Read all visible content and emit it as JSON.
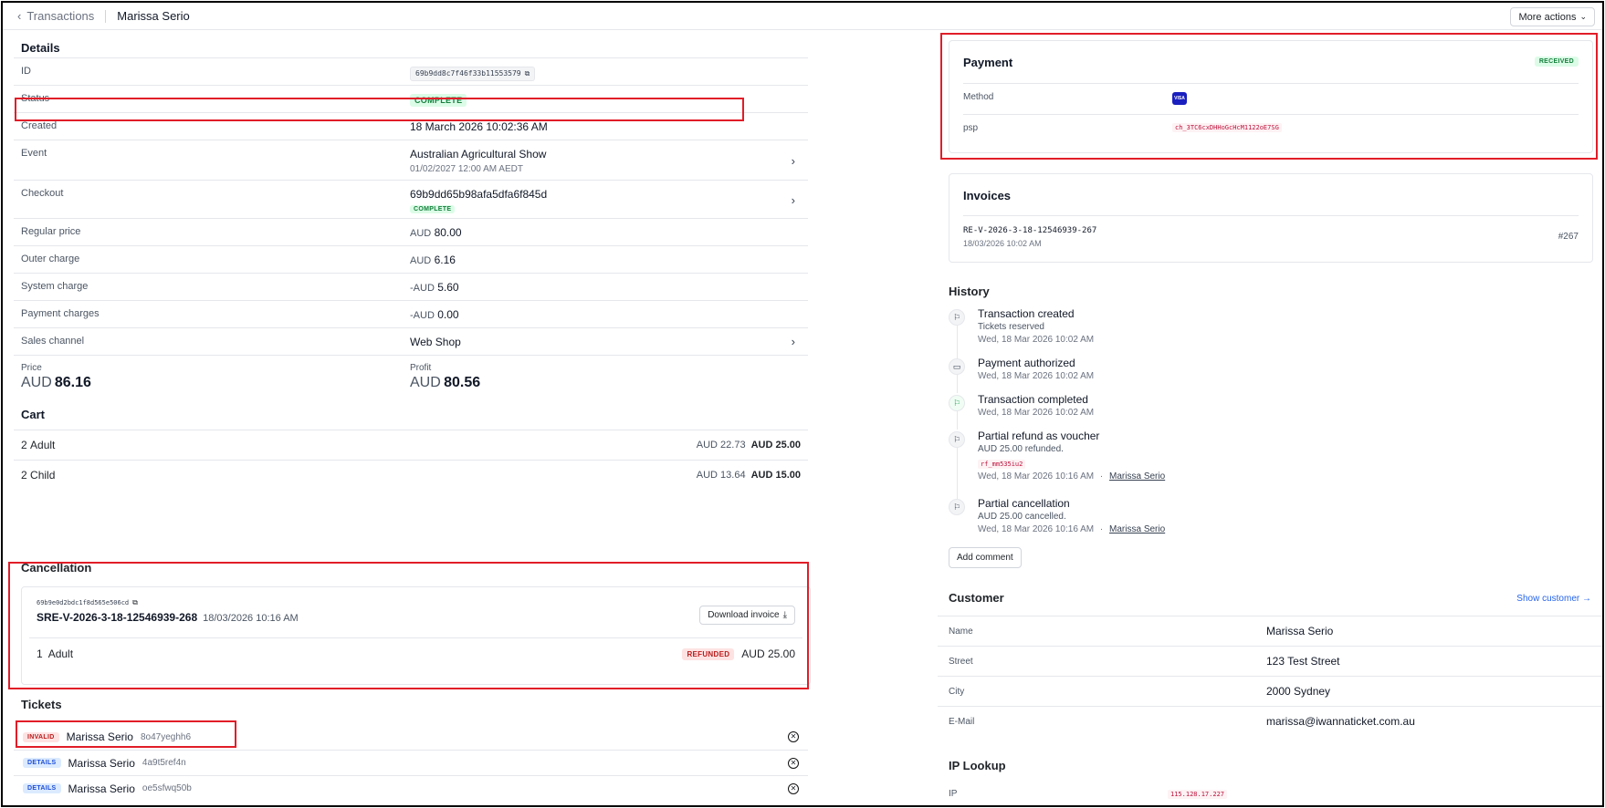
{
  "breadcrumb": {
    "back_label": "Transactions",
    "current": "Marissa Serio"
  },
  "header": {
    "more_actions": "More actions"
  },
  "details": {
    "title": "Details",
    "id_label": "ID",
    "id_value": "69b9dd8c7f46f33b11553579",
    "status_label": "Status",
    "status_value": "COMPLETE",
    "created_label": "Created",
    "created_value": "18 March 2026 10:02:36 AM",
    "event_label": "Event",
    "event_name": "Australian Agricultural Show",
    "event_date": "01/02/2027 12:00 AM AEDT",
    "checkout_label": "Checkout",
    "checkout_id": "69b9dd65b98afa5dfa6f845d",
    "checkout_status": "COMPLETE",
    "regular_price_label": "Regular price",
    "regular_price_cur": "AUD",
    "regular_price_val": "80.00",
    "outer_charge_label": "Outer charge",
    "outer_charge_cur": "AUD",
    "outer_charge_val": "6.16",
    "system_charge_label": "System charge",
    "system_charge_cur": "-AUD",
    "system_charge_val": "5.60",
    "payment_charges_label": "Payment charges",
    "payment_charges_cur": "-AUD",
    "payment_charges_val": "0.00",
    "sales_channel_label": "Sales channel",
    "sales_channel_val": "Web Shop",
    "price_label": "Price",
    "price_cur": "AUD",
    "price_val": "86.16",
    "profit_label": "Profit",
    "profit_cur": "AUD",
    "profit_val": "80.56"
  },
  "cart": {
    "title": "Cart",
    "items": [
      {
        "qty": "2",
        "name": "Adult",
        "net": "AUD 22.73",
        "gross": "AUD 25.00"
      },
      {
        "qty": "2",
        "name": "Child",
        "net": "AUD 13.64",
        "gross": "AUD 15.00"
      }
    ]
  },
  "cancellation": {
    "title": "Cancellation",
    "id": "69b9e0d2bdc1f8d565e506cd",
    "invoice": "SRE-V-2026-3-18-12546939-268",
    "date": "18/03/2026 10:16 AM",
    "download_label": "Download invoice",
    "item_qty": "1",
    "item_name": "Adult",
    "item_status": "REFUNDED",
    "item_amount": "AUD 25.00"
  },
  "tickets": {
    "title": "Tickets",
    "items": [
      {
        "badge": "INVALID",
        "name": "Marissa Serio",
        "code": "8o47yeghh6"
      },
      {
        "badge": "DETAILS",
        "name": "Marissa Serio",
        "code": "4a9t5ref4n"
      },
      {
        "badge": "DETAILS",
        "name": "Marissa Serio",
        "code": "oe5sfwq50b"
      }
    ]
  },
  "payment": {
    "title": "Payment",
    "status": "RECEIVED",
    "method_label": "Method",
    "method_icon_text": "VISA",
    "psp_label": "psp",
    "psp_value": "ch_3TC6cxDHHoGcHcM1122oE7SG"
  },
  "invoices": {
    "title": "Invoices",
    "number": "RE-V-2026-3-18-12546939-267",
    "date": "18/03/2026 10:02 AM",
    "ref": "#267"
  },
  "history": {
    "title": "History",
    "items": [
      {
        "title": "Transaction created",
        "sub": "Tickets reserved",
        "time": "Wed, 18 Mar 2026 10:02 AM"
      },
      {
        "title": "Payment authorized",
        "time": "Wed, 18 Mar 2026 10:02 AM"
      },
      {
        "title": "Transaction completed",
        "time": "Wed, 18 Mar 2026 10:02 AM"
      },
      {
        "title": "Partial refund as voucher",
        "sub": "AUD 25.00 refunded.",
        "code": "rf_mm535iu2",
        "time": "Wed, 18 Mar 2026 10:16 AM",
        "user": "Marissa Serio"
      },
      {
        "title": "Partial cancellation",
        "sub": "AUD 25.00 cancelled.",
        "time": "Wed, 18 Mar 2026 10:16 AM",
        "user": "Marissa Serio"
      }
    ],
    "add_comment": "Add comment",
    "separator": "·"
  },
  "customer": {
    "title": "Customer",
    "show_link": "Show customer →",
    "name_label": "Name",
    "name_val": "Marissa Serio",
    "street_label": "Street",
    "street_val": "123 Test Street",
    "city_label": "City",
    "city_val": "2000 Sydney",
    "email_label": "E-Mail",
    "email_val": "marissa@iwannaticket.com.au"
  },
  "ip_lookup": {
    "title": "IP Lookup",
    "ip_label": "IP",
    "ip_val": "115.128.17.227"
  }
}
